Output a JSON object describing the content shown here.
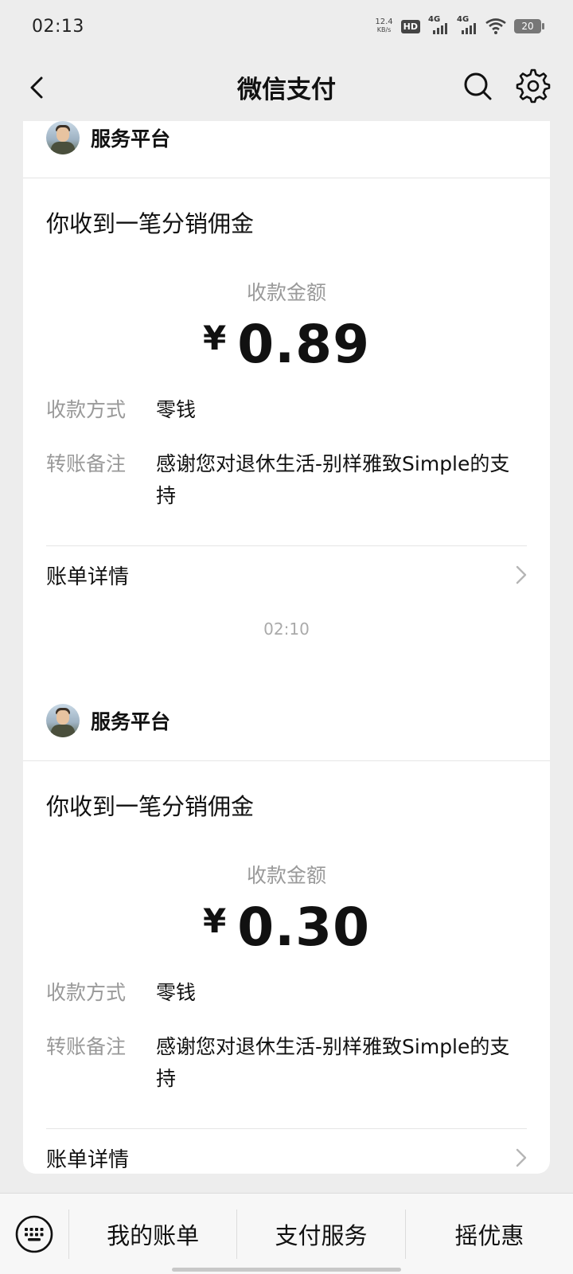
{
  "status_bar": {
    "time": "02:13",
    "net_speed_value": "12.4",
    "net_speed_unit": "KB/s",
    "hd_label": "HD",
    "signal_1": "4G",
    "signal_2": "4G",
    "battery": "20"
  },
  "nav": {
    "title": "微信支付"
  },
  "timestamp": "02:10",
  "cards": [
    {
      "platform": "服务平台",
      "title": "你收到一笔分销佣金",
      "amount_label": "收款金额",
      "currency": "¥",
      "amount": "0.89",
      "method_key": "收款方式",
      "method_val": "零钱",
      "note_key": "转账备注",
      "note_val": "感谢您对退休生活-别样雅致Simple的支持",
      "detail_label": "账单详情"
    },
    {
      "platform": "服务平台",
      "title": "你收到一笔分销佣金",
      "amount_label": "收款金额",
      "currency": "¥",
      "amount": "0.30",
      "method_key": "收款方式",
      "method_val": "零钱",
      "note_key": "转账备注",
      "note_val": "感谢您对退休生活-别样雅致Simple的支持",
      "detail_label": "账单详情"
    }
  ],
  "bottom_bar": {
    "items": [
      "我的账单",
      "支付服务",
      "摇优惠"
    ]
  }
}
